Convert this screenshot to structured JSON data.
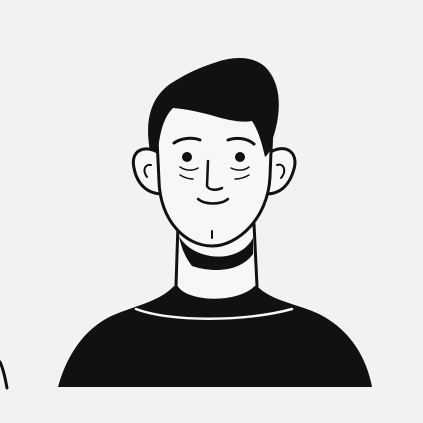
{
  "illustration": {
    "icon": "man-avatar-icon",
    "colors": {
      "background": "#f2f2f0",
      "ink": "#111111",
      "skin": "#f7f7f5"
    }
  }
}
